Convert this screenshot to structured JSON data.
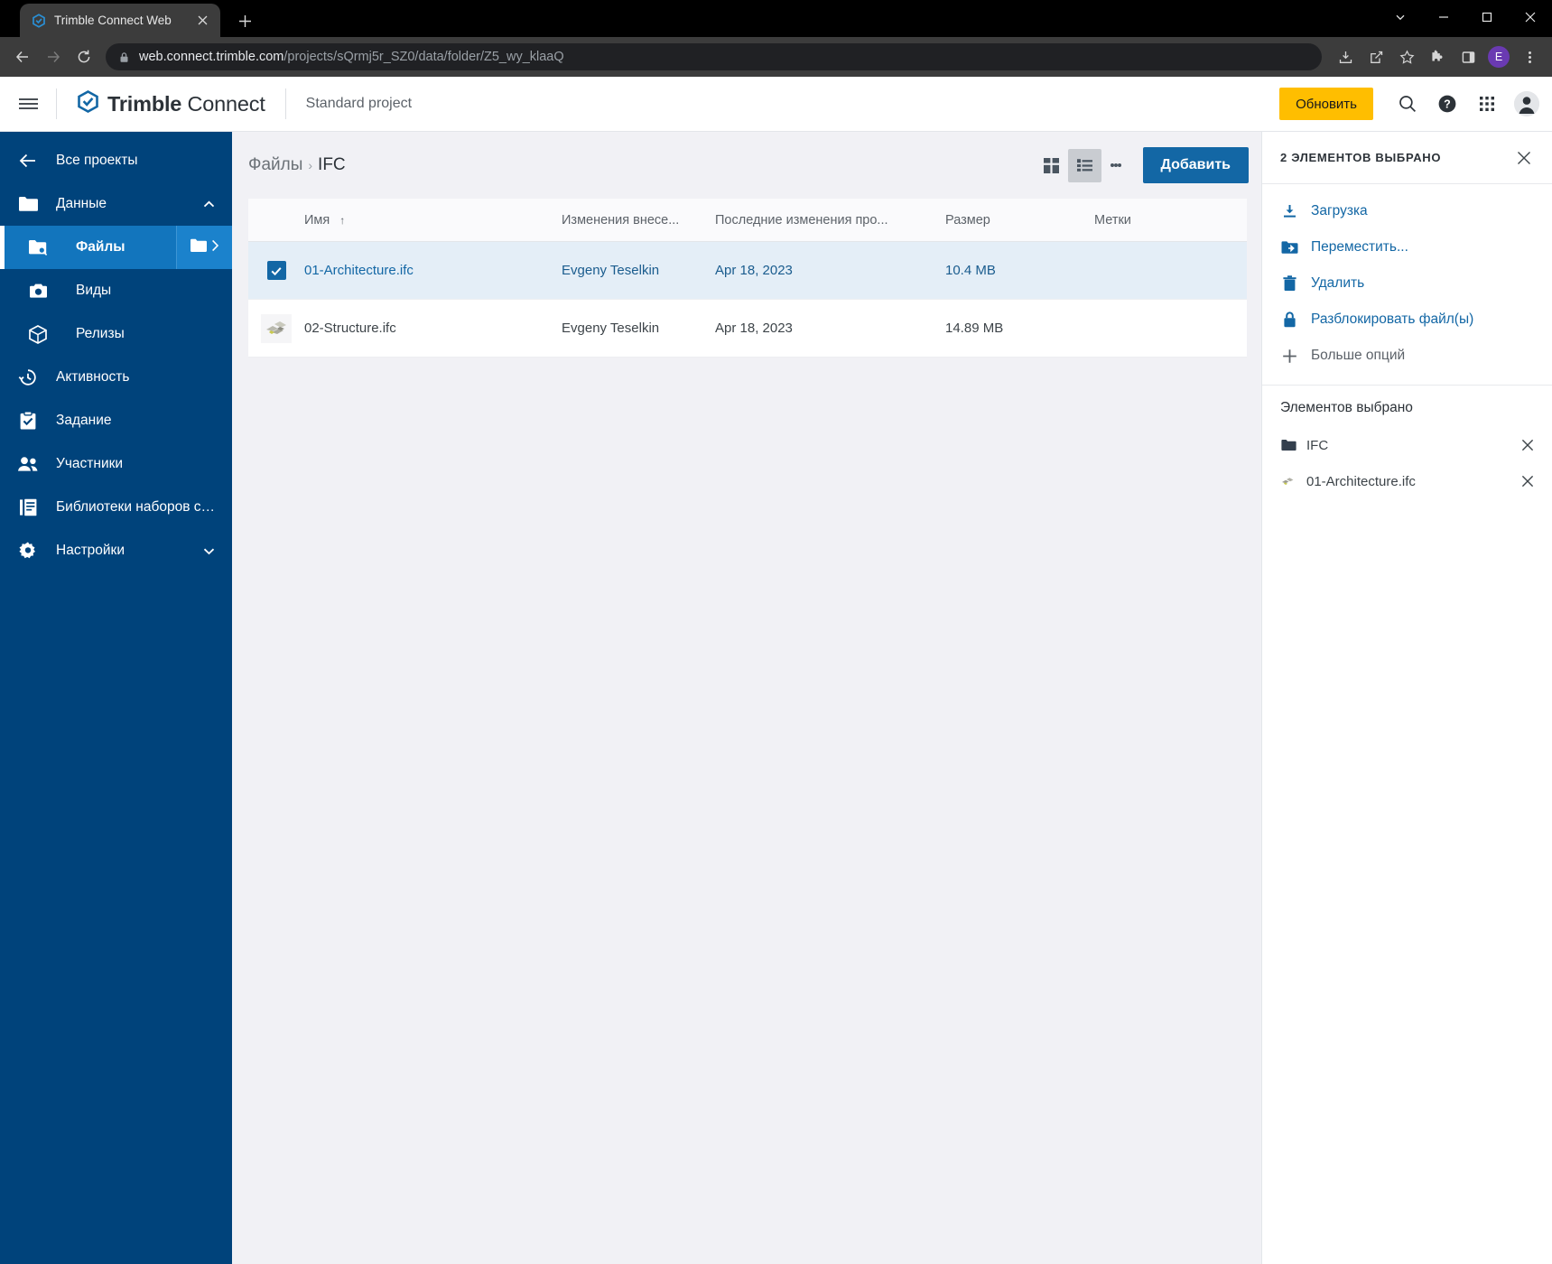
{
  "browser": {
    "tab": {
      "title": "Trimble Connect Web",
      "favicon_icon": "trimble-favicon",
      "close_icon": "close-icon"
    },
    "new_tab_icon": "plus-icon",
    "window_controls": {
      "list_icon": "chevron-down-icon",
      "minimize_icon": "minimize-icon",
      "maximize_icon": "maximize-icon",
      "close_icon": "close-icon"
    },
    "nav": {
      "back_icon": "back-arrow-icon",
      "forward_icon": "forward-arrow-icon",
      "reload_icon": "reload-icon"
    },
    "omnibox": {
      "lock_icon": "lock-icon",
      "url_domain": "web.connect.trimble.com",
      "url_path": "/projects/sQrmj5r_SZ0/data/folder/Z5_wy_klaaQ"
    },
    "toolbar_right": {
      "install_icon": "install-app-icon",
      "share_icon": "share-icon",
      "bookmark_icon": "star-icon",
      "extensions_icon": "puzzle-icon",
      "sidepanel_icon": "side-panel-icon",
      "profile_initial": "E",
      "menu_icon": "kebab-menu-icon"
    }
  },
  "header": {
    "menu_icon": "hamburger-icon",
    "logo_icon": "trimble-logo-icon",
    "brand_bold": "Trimble",
    "brand_light": "Connect",
    "project_name": "Standard project",
    "update_button": "Обновить",
    "search_icon": "search-icon",
    "help_icon": "help-icon",
    "apps_icon": "apps-grid-icon",
    "account_icon": "user-avatar-icon"
  },
  "sidebar": {
    "back_label": "Все проекты",
    "back_icon": "back-arrow-icon",
    "items": [
      {
        "label": "Данные",
        "icon": "folder-icon",
        "chevron": "chevron-up-icon",
        "level": 0,
        "active": false
      },
      {
        "label": "Файлы",
        "icon": "files-search-icon",
        "level": 1,
        "active": true,
        "folder_icon": "folder-icon",
        "folder_chevron": "chevron-right-icon"
      },
      {
        "label": "Виды",
        "icon": "camera-icon",
        "level": 1,
        "active": false
      },
      {
        "label": "Релизы",
        "icon": "box-icon",
        "level": 1,
        "active": false
      },
      {
        "label": "Активность",
        "icon": "history-clock-icon",
        "level": 0,
        "active": false
      },
      {
        "label": "Задание",
        "icon": "clipboard-check-icon",
        "level": 0,
        "active": false
      },
      {
        "label": "Участники",
        "icon": "people-icon",
        "level": 0,
        "active": false
      },
      {
        "label": "Библиотеки наборов св...",
        "icon": "library-icon",
        "level": 0,
        "active": false
      },
      {
        "label": "Настройки",
        "icon": "gear-icon",
        "chevron": "chevron-down-icon",
        "level": 0,
        "active": false
      }
    ]
  },
  "main": {
    "breadcrumb": {
      "root": "Файлы",
      "separator": "›",
      "current": "IFC"
    },
    "toolbar": {
      "grid_view_icon": "grid-view-icon",
      "list_view_icon": "list-view-icon",
      "more_icon": "kebab-menu-icon",
      "add_button": "Добавить"
    },
    "table": {
      "columns": [
        "Имя",
        "Изменения внесе...",
        "Последние изменения про...",
        "Размер",
        "Метки"
      ],
      "sort_column": "Имя",
      "sort_icon": "sort-ascending-arrow",
      "rows": [
        {
          "selected": true,
          "checkbox_icon": "checkbox-checked-icon",
          "name": "01-Architecture.ifc",
          "modified_by": "Evgeny Teselkin",
          "last_modified": "Apr 18, 2023",
          "size": "10.4 MB",
          "tags": ""
        },
        {
          "selected": false,
          "thumb_icon": "ifc-model-thumbnail",
          "name": "02-Structure.ifc",
          "modified_by": "Evgeny Teselkin",
          "last_modified": "Apr 18, 2023",
          "size": "14.89 MB",
          "tags": ""
        }
      ]
    }
  },
  "right_panel": {
    "title": "2 ЭЛЕМЕНТОВ ВЫБРАНО",
    "close_icon": "close-icon",
    "actions": [
      {
        "label": "Загрузка",
        "icon": "download-icon",
        "style": "link"
      },
      {
        "label": "Переместить...",
        "icon": "move-folder-icon",
        "style": "link"
      },
      {
        "label": "Удалить",
        "icon": "trash-icon",
        "style": "link"
      },
      {
        "label": "Разблокировать файл(ы)",
        "icon": "lock-icon",
        "style": "link"
      },
      {
        "label": "Больше опций",
        "icon": "plus-icon",
        "style": "grey"
      }
    ],
    "section_title": "Элементов выбрано",
    "items": [
      {
        "label": "IFC",
        "icon": "folder-icon",
        "remove_icon": "close-icon"
      },
      {
        "label": "01-Architecture.ifc",
        "icon": "ifc-file-icon",
        "remove_icon": "close-icon"
      }
    ]
  },
  "colors": {
    "sidebar_bg": "#00437b",
    "sidebar_active": "#1275bd",
    "accent_blue": "#1367a5",
    "update_yellow": "#ffbe00",
    "selected_row": "#e4eef7",
    "canvas": "#f1f1f5"
  }
}
